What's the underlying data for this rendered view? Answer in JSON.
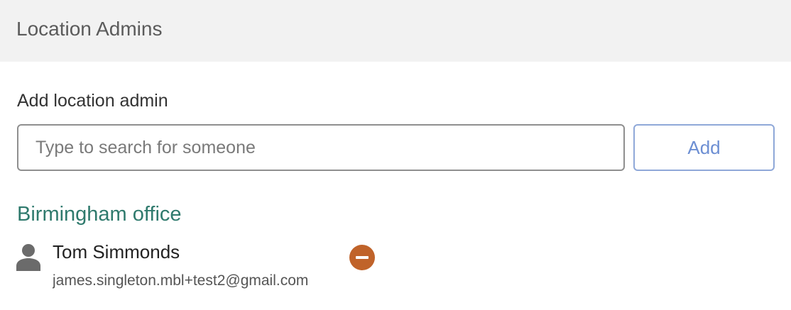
{
  "header": {
    "title": "Location Admins"
  },
  "add_admin": {
    "label": "Add location admin",
    "search_placeholder": "Type to search for someone",
    "search_value": "",
    "add_button_label": "Add"
  },
  "locations": [
    {
      "name": "Birmingham office",
      "admins": [
        {
          "name": "Tom Simmonds",
          "email": "james.singleton.mbl+test2@gmail.com",
          "avatar_icon": "person-icon",
          "remove_icon": "minus-circle-icon"
        }
      ]
    }
  ],
  "colors": {
    "header_bg": "#f2f2f2",
    "group_title": "#2f7a6d",
    "add_button": "#6d8fd3",
    "remove_button": "#c0632a"
  }
}
